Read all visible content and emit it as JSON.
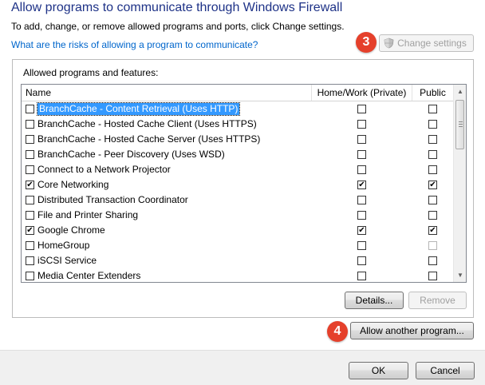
{
  "header": {
    "title": "Allow programs to communicate through Windows Firewall",
    "description": "To add, change, or remove allowed programs and ports, click Change settings.",
    "risk_link": "What are the risks of allowing a program to communicate?",
    "change_settings_label": "Change settings",
    "badge_change_settings": "3"
  },
  "group": {
    "title": "Allowed programs and features:",
    "columns": [
      "Name",
      "Home/Work (Private)",
      "Public"
    ],
    "rows": [
      {
        "name": "BranchCache - Content Retrieval (Uses HTTP)",
        "enabled": false,
        "private": false,
        "public": false,
        "selected": true
      },
      {
        "name": "BranchCache - Hosted Cache Client (Uses HTTPS)",
        "enabled": false,
        "private": false,
        "public": false
      },
      {
        "name": "BranchCache - Hosted Cache Server (Uses HTTPS)",
        "enabled": false,
        "private": false,
        "public": false
      },
      {
        "name": "BranchCache - Peer Discovery (Uses WSD)",
        "enabled": false,
        "private": false,
        "public": false
      },
      {
        "name": "Connect to a Network Projector",
        "enabled": false,
        "private": false,
        "public": false
      },
      {
        "name": "Core Networking",
        "enabled": true,
        "private": true,
        "public": true
      },
      {
        "name": "Distributed Transaction Coordinator",
        "enabled": false,
        "private": false,
        "public": false
      },
      {
        "name": "File and Printer Sharing",
        "enabled": false,
        "private": false,
        "public": false
      },
      {
        "name": "Google Chrome",
        "enabled": true,
        "private": true,
        "public": true
      },
      {
        "name": "HomeGroup",
        "enabled": false,
        "private": false,
        "public": false,
        "public_disabled": true
      },
      {
        "name": "iSCSI Service",
        "enabled": false,
        "private": false,
        "public": false
      },
      {
        "name": "Media Center Extenders",
        "enabled": false,
        "private": false,
        "public": false
      }
    ],
    "details_label": "Details...",
    "remove_label": "Remove"
  },
  "allow_another_label": "Allow another program...",
  "badge_allow_another": "4",
  "footer": {
    "ok_label": "OK",
    "cancel_label": "Cancel"
  },
  "colors": {
    "title": "#1e3287",
    "link": "#0066cc",
    "selection": "#3399ff",
    "badge": "#e5402b"
  }
}
